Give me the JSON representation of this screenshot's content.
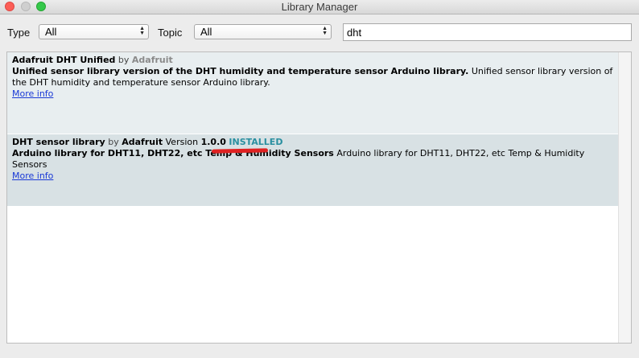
{
  "window": {
    "title": "Library Manager"
  },
  "filters": {
    "type_label": "Type",
    "type_value": "All",
    "topic_label": "Topic",
    "topic_value": "All",
    "search_value": "dht"
  },
  "libraries": [
    {
      "name": "Adafruit DHT Unified",
      "by": "by",
      "author": "Adafruit",
      "sentence": "Unified sensor library version of the DHT humidity and temperature sensor Arduino library.",
      "paragraph": "Unified sensor library version of the DHT humidity and temperature sensor Arduino library.",
      "more_info": "More info"
    },
    {
      "name": "DHT sensor library",
      "by": "by",
      "author": "Adafruit",
      "version_label": "Version",
      "version": "1.0.0",
      "status": "INSTALLED",
      "sentence": "Arduino library for DHT11, DHT22, etc Temp & Humidity Sensors",
      "paragraph": "Arduino library for DHT11, DHT22, etc Temp & Humidity Sensors",
      "more_info": "More info"
    }
  ],
  "colors": {
    "installed": "#2a8fa0",
    "link": "#1a39d6",
    "annotation": "#e02222"
  }
}
